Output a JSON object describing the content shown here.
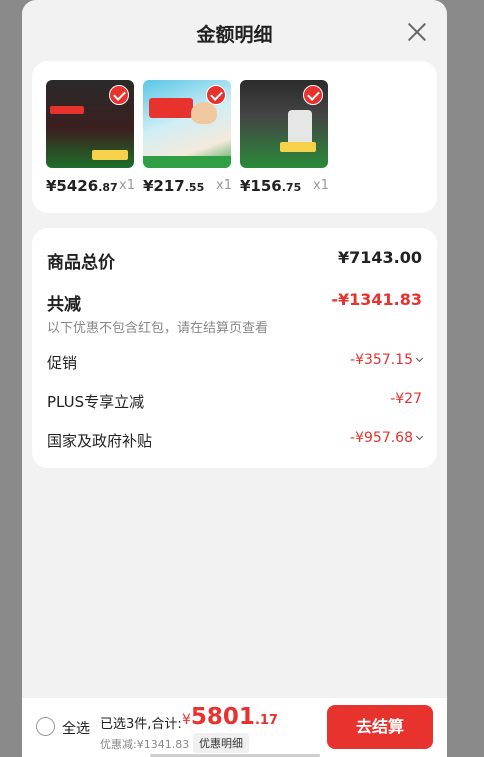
{
  "header": {
    "title": "金额明细"
  },
  "products": [
    {
      "price_int": "¥5426",
      "price_dec": ".87",
      "qty": "x1",
      "checked": true
    },
    {
      "price_int": "¥217",
      "price_dec": ".55",
      "qty": "x1",
      "checked": true
    },
    {
      "price_int": "¥156",
      "price_dec": ".75",
      "qty": "x1",
      "checked": true
    }
  ],
  "summary": {
    "total_label": "商品总价",
    "total_value": "¥7143.00",
    "discount_label": "共减",
    "discount_value": "-¥1341.83",
    "discount_note": "以下优惠不包含红包，请在结算页查看",
    "items": [
      {
        "label": "促销",
        "value": "-¥357.15",
        "expandable": true
      },
      {
        "label": "PLUS专享立减",
        "value": "-¥27",
        "expandable": false
      },
      {
        "label": "国家及政府补贴",
        "value": "-¥957.68",
        "expandable": true
      }
    ]
  },
  "footer": {
    "select_all": "全选",
    "selected_text": "已选3件,合计:",
    "currency": "¥",
    "amount_int": "5801",
    "amount_dec": ".17",
    "discount_text": "优惠减:¥1341.83",
    "detail_link": "优惠明细",
    "checkout_label": "去结算"
  },
  "colors": {
    "accent": "#e8322d",
    "background": "#f2f2f2"
  }
}
